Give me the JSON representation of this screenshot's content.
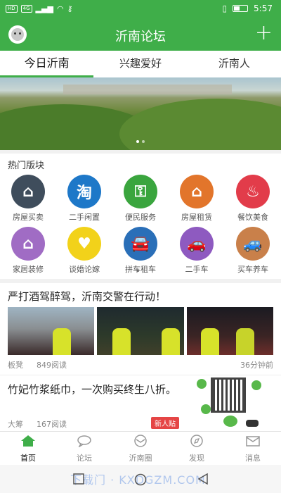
{
  "status_bar": {
    "left_chip1": "HD",
    "left_chip2": "4G",
    "time": "5:57"
  },
  "header": {
    "title": "沂南论坛",
    "plus_label": "+"
  },
  "tabs": [
    {
      "label": "今日沂南",
      "active": true
    },
    {
      "label": "兴趣爱好",
      "active": false
    },
    {
      "label": "沂南人",
      "active": false
    }
  ],
  "hot_sections": {
    "title": "热门版块",
    "items": [
      {
        "label": "房屋买卖",
        "icon": "house-icon",
        "color": "#3f4d5c",
        "glyph": "⌂"
      },
      {
        "label": "二手闲置",
        "icon": "taobao-icon",
        "color": "#1e78c8",
        "glyph": "淘"
      },
      {
        "label": "便民服务",
        "icon": "key-icon",
        "color": "#3aa53e",
        "glyph": "⚿"
      },
      {
        "label": "房屋租赁",
        "icon": "house-rent-icon",
        "color": "#e2752b",
        "glyph": "⌂"
      },
      {
        "label": "餐饮美食",
        "icon": "dining-icon",
        "color": "#e23c4a",
        "glyph": "♨"
      },
      {
        "label": "家居装修",
        "icon": "home-decor-icon",
        "color": "#a06cc4",
        "glyph": "⌂"
      },
      {
        "label": "谈婚论嫁",
        "icon": "wedding-icon",
        "color": "#f2d21a",
        "glyph": "♥"
      },
      {
        "label": "拼车租车",
        "icon": "carpool-icon",
        "color": "#2a6fb8",
        "glyph": "🚘"
      },
      {
        "label": "二手车",
        "icon": "used-car-icon",
        "color": "#8e5ac0",
        "glyph": "🚗"
      },
      {
        "label": "买车养车",
        "icon": "car-care-icon",
        "color": "#c9804a",
        "glyph": "🚙"
      }
    ]
  },
  "news": [
    {
      "title": "严打酒驾醉驾，沂南交警在行动！",
      "author": "板凳",
      "views": "849阅读",
      "time": "36分钟前"
    },
    {
      "title": "竹妃竹浆纸巾，一次购买终生八折。",
      "author": "大筹",
      "views": "167阅读",
      "badge": "新人贴"
    }
  ],
  "bottom_nav": [
    {
      "label": "首页",
      "icon": "home-icon",
      "active": true
    },
    {
      "label": "论坛",
      "icon": "forum-icon",
      "active": false
    },
    {
      "label": "沂南圈",
      "icon": "circle-icon",
      "active": false
    },
    {
      "label": "发现",
      "icon": "discover-icon",
      "active": false
    },
    {
      "label": "消息",
      "icon": "message-icon",
      "active": false
    }
  ],
  "colors": {
    "brand_green": "#3fae49",
    "badge_red": "#e54545"
  }
}
